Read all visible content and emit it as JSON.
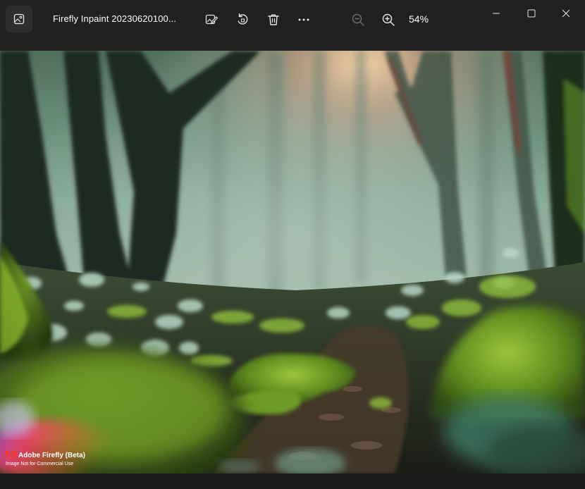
{
  "window": {
    "title": "Firefly Inpaint 20230620100...",
    "zoom_level": "54%"
  },
  "toolbar": {
    "icons": [
      "edit-image-icon",
      "rotate-icon",
      "delete-icon",
      "more-icon",
      "zoom-out-icon",
      "zoom-in-icon"
    ]
  },
  "window_controls": [
    "minimize-icon",
    "maximize-icon",
    "close-icon"
  ],
  "watermark": {
    "brand": "Adobe Firefly (Beta)",
    "note": "Image Not for Commercial Use"
  },
  "colors": {
    "titlebar": "#202020",
    "text": "#ffffff",
    "disabled_icon": "#6d6d6d",
    "adobe_red": "#ff3b1f"
  }
}
